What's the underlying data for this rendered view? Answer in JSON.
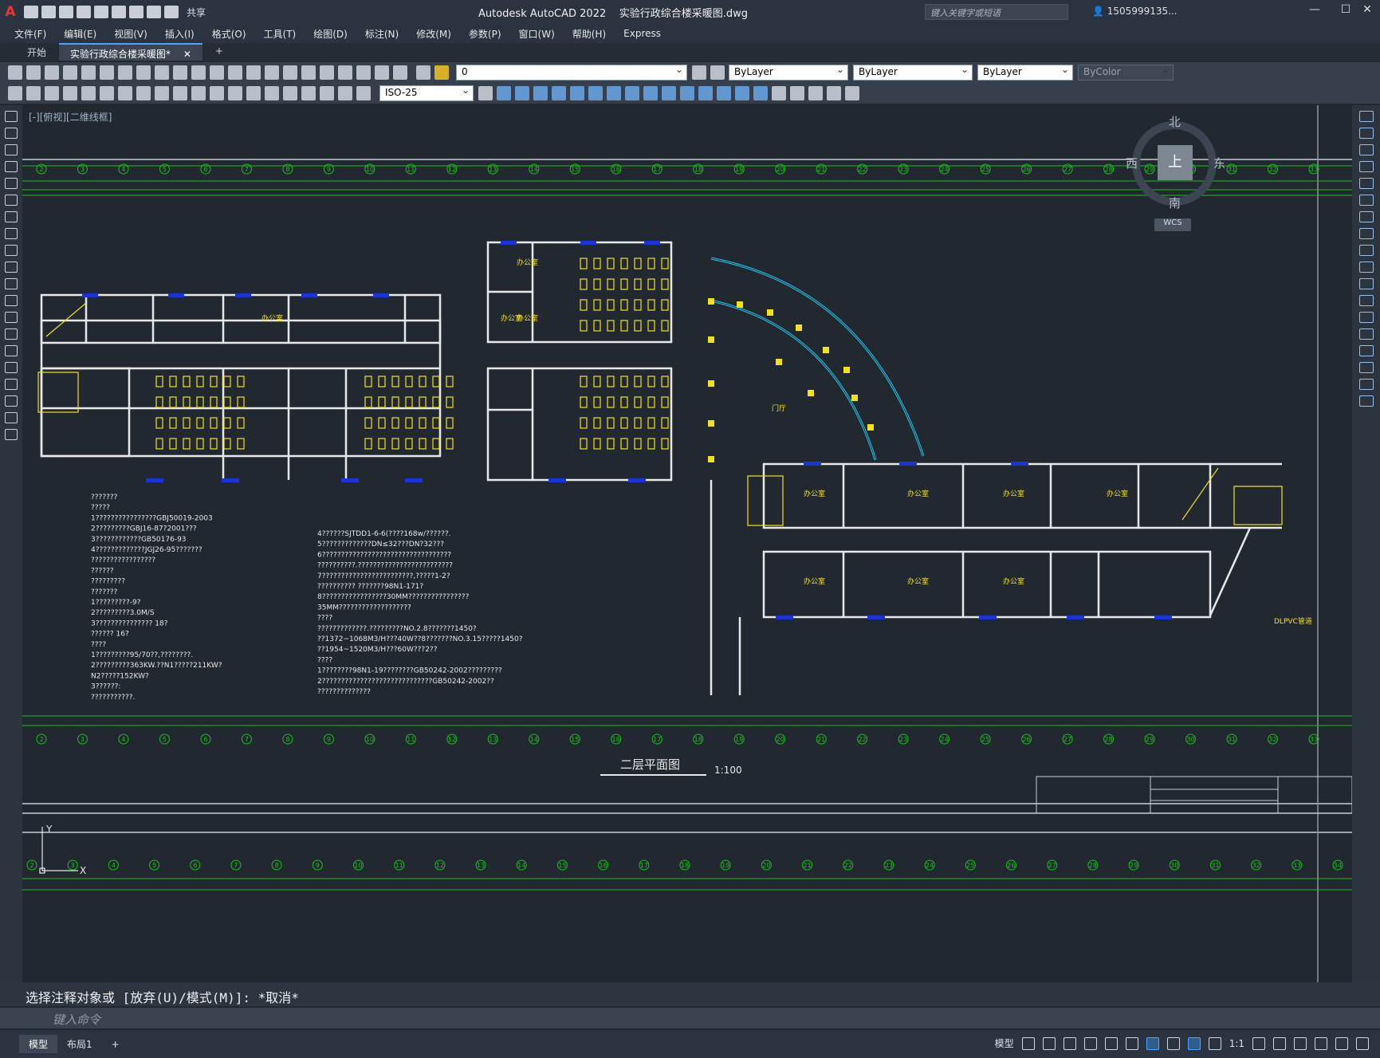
{
  "window": {
    "app_name": "Autodesk AutoCAD 2022",
    "file_name": "实验行政综合楼采暖图.dwg",
    "search_placeholder": "键入关键字或短语",
    "user": "1505999135...",
    "share_label": "共享"
  },
  "menu": [
    "文件(F)",
    "编辑(E)",
    "视图(V)",
    "插入(I)",
    "格式(O)",
    "工具(T)",
    "绘图(D)",
    "标注(N)",
    "修改(M)",
    "参数(P)",
    "窗口(W)",
    "帮助(H)",
    "Express"
  ],
  "tabs": [
    {
      "label": "开始"
    },
    {
      "label": "实验行政综合楼采暖图*"
    }
  ],
  "properties": {
    "layer": "0",
    "color": "ByLayer",
    "linetype": "ByLayer",
    "lineweight": "ByLayer",
    "plotstyle": "ByColor",
    "dimstyle": "ISO-25"
  },
  "viewport": {
    "label": "[-][俯视][二维线框]",
    "viewcube": {
      "north": "北",
      "south": "南",
      "east": "东",
      "west": "西",
      "face": "上",
      "wcs": "WCS"
    }
  },
  "drawing": {
    "title": "二层平面图",
    "scale": "1:100",
    "axes": [
      "2",
      "3",
      "4",
      "5",
      "6",
      "7",
      "8",
      "9",
      "10",
      "11",
      "12",
      "13",
      "14",
      "15",
      "16",
      "17",
      "18",
      "19",
      "20",
      "21",
      "22",
      "23",
      "24",
      "25",
      "26",
      "27",
      "28",
      "29",
      "30",
      "31",
      "32",
      "33",
      "34"
    ],
    "hall_label": "门厅",
    "office_label": "办公室",
    "note_pipe": "DLPVC管道",
    "notes_left": [
      "???????",
      "?????",
      "1????????????????GBJ50019-2003",
      "2?????????GBJ16-87?2001???",
      "3????????????GB50176-93",
      "4?????????????JGJ26-95???????",
      "?????????????????",
      "??????",
      "?????????",
      "???????",
      "1?????????-9?",
      "2?????????3.0M/S",
      "3???????????????  18?",
      "?????? 16?",
      "????",
      "1?????????95/70??,????????.",
      "2?????????363KW.??N1?????211KW?",
      "N2?????152KW?",
      "3??????:",
      "???????????."
    ],
    "notes_right": [
      "4??????SJTDD1-6-6(????168w/??????.",
      "5?????????????DN≤32???DN?32???",
      "6??????????????????????????????????",
      "??????????.?????????????????????????",
      "7????????????????????????,?????1-2?",
      "??????????      ???????98N1-171?",
      "8?????????????????30MM????????????????",
      "35MM???????????????????",
      "????",
      "?????????????.?????????NO.2.8???????1450?",
      "??1372~1068M3/H???40W??8???????NO.3.15?????1450?",
      "??1954~1520M3/H???60W???2??",
      "????",
      "1????????98N1-19????????GB50242-2002?????????",
      "2?????????????????????????????GB50242-2002??",
      "??????????????"
    ]
  },
  "command": {
    "history": "选择注释对象或 [放弃(U)/模式(M)]: *取消*",
    "placeholder": "键入命令"
  },
  "status": {
    "tabs": [
      "模型",
      "布局1"
    ],
    "model_label": "模型",
    "scale": "1:1"
  }
}
